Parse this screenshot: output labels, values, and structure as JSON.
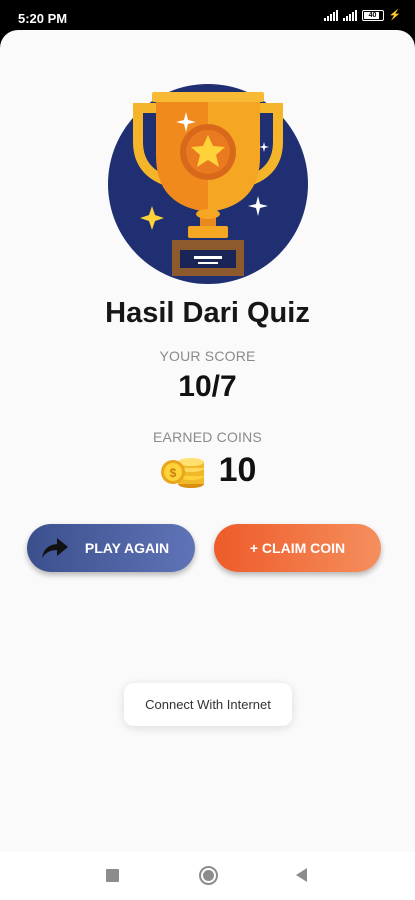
{
  "status_bar": {
    "time": "5:20 PM",
    "battery_level": "40",
    "icons": [
      "signal-icon",
      "signal-icon",
      "battery-icon",
      "charging-icon"
    ]
  },
  "result": {
    "title": "Hasil Dari Quiz",
    "score_label": "YOUR SCORE",
    "score_value": "10/7",
    "coins_label": "EARNED COINS",
    "coins_value": "10"
  },
  "buttons": {
    "play_again_label": "PLAY AGAIN",
    "claim_coin_label": "+ CLAIM COIN"
  },
  "toast": {
    "message": "Connect With Internet"
  },
  "colors": {
    "play_again_start": "#3c4f8d",
    "play_again_end": "#5f74b7",
    "claim_coin_start": "#ee5b2a",
    "claim_coin_end": "#f58f5d",
    "trophy_circle": "#1f2f72",
    "trophy_gold": "#f5a623"
  }
}
